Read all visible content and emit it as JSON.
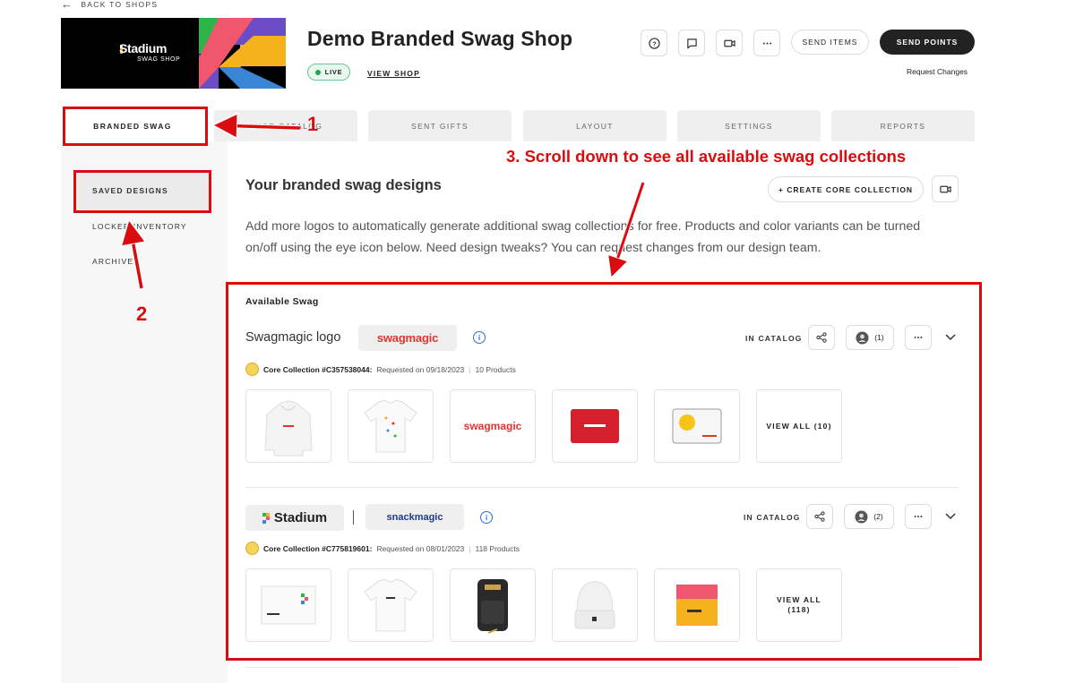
{
  "header": {
    "back_label": "BACK TO SHOPS",
    "banner_logo_text": "Stadium",
    "banner_sub_text": "SWAG SHOP",
    "shop_title": "Demo Branded Swag Shop",
    "live_label": "LIVE",
    "view_shop_label": "VIEW SHOP",
    "send_items_label": "SEND ITEMS",
    "send_points_label": "SEND POINTS",
    "request_changes_label": "Request Changes"
  },
  "tabs": [
    {
      "label": "BRANDED SWAG",
      "active": true
    },
    {
      "label": "SHOP CATALOG"
    },
    {
      "label": "SENT GIFTS"
    },
    {
      "label": "LAYOUT"
    },
    {
      "label": "SETTINGS"
    },
    {
      "label": "REPORTS"
    }
  ],
  "sidebar": {
    "items": [
      {
        "label": "SAVED DESIGNS",
        "active": true
      },
      {
        "label": "LOCKER INVENTORY"
      },
      {
        "label": "ARCHIVED"
      }
    ]
  },
  "main": {
    "title": "Your branded swag designs",
    "create_button": "+ CREATE CORE COLLECTION",
    "description": "Add more logos to automatically generate additional swag collections for free. Products and color variants can be turned on/off using the eye icon below. Need design tweaks? You can request changes from our design team.",
    "available_label": "Available Swag"
  },
  "collections": [
    {
      "name": "Swagmagic logo",
      "logo_text": "swagmagic",
      "status": "IN CATALOG",
      "users_count": "(1)",
      "collection_id": "Core Collection #C357538044:",
      "requested": "Requested on 09/18/2023",
      "products": "10 Products",
      "view_all": "VIEW ALL (10)"
    },
    {
      "logo_text_a": "Stadium",
      "logo_text_b": "snackmagic",
      "status": "IN CATALOG",
      "users_count": "(2)",
      "collection_id": "Core Collection #C775819601:",
      "requested": "Requested on 08/01/2023",
      "products": "118 Products",
      "view_all_line1": "VIEW ALL",
      "view_all_line2": "(118)"
    }
  ],
  "annotations": {
    "step1": "1",
    "step2": "2",
    "step3": "3. Scroll down to see all available swag collections"
  },
  "colors": {
    "annotation_red": "#d90d10",
    "primary_dark": "#222222",
    "live_green": "#22a454",
    "info_blue": "#2f6fd6"
  }
}
